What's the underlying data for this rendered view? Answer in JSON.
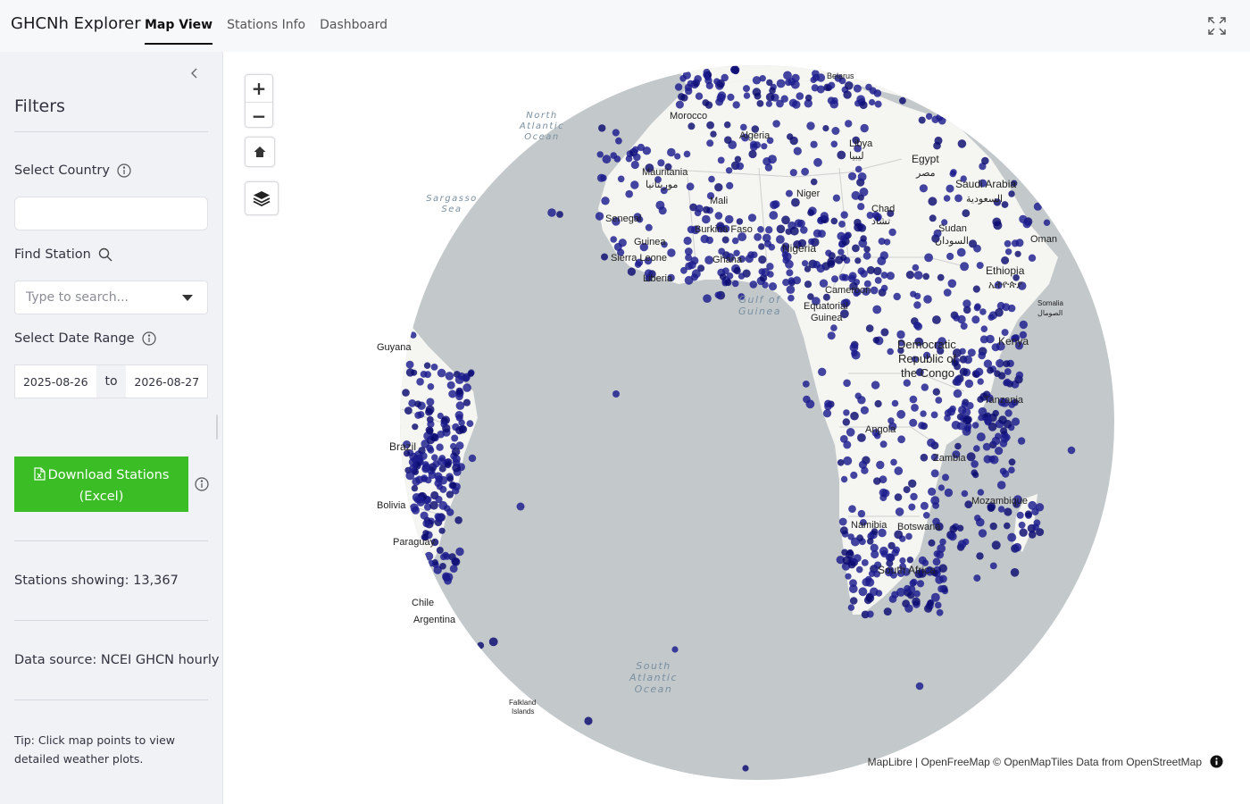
{
  "app": {
    "title": "GHCNh Explorer"
  },
  "nav": {
    "tabs": [
      {
        "label": "Map View"
      },
      {
        "label": "Stations Info"
      },
      {
        "label": "Dashboard"
      }
    ],
    "active": 0
  },
  "sidebar": {
    "title": "Filters",
    "country": {
      "label": "Select Country",
      "value": ""
    },
    "station": {
      "label": "Find Station",
      "placeholder": "Type to search..."
    },
    "date_range": {
      "label": "Select Date Range",
      "start": "2025-08-26",
      "separator": "to",
      "end": "2026-08-27"
    },
    "download": {
      "line1": "Download Stations",
      "line2": "(Excel)"
    },
    "stations_showing": "Stations showing: 13,367",
    "data_source": "Data source: NCEI GHCN hourly",
    "tip": "Tip: Click map points to view detailed weather plots."
  },
  "map": {
    "zoom_in": "+",
    "zoom_out": "−",
    "attribution": {
      "maplibre": "MapLibre",
      "sep1": " | ",
      "openfreemap": "OpenFreeMap",
      "copy": " © ",
      "openmaptiles": "OpenMapTiles",
      "data_from": " Data from ",
      "osm": "OpenStreetMap"
    },
    "ocean_labels": [
      "North",
      "Atlantic",
      "Ocean",
      "Sargasso",
      "Sea",
      "Gulf of",
      "Guinea",
      "South",
      "Atlantic",
      "Ocean"
    ],
    "country_labels": [
      "Mauritania",
      "موريتانيا",
      "Mali",
      "Niger",
      "Libya",
      "ليبيا",
      "Egypt",
      "مصر",
      "Chad",
      "تشاد",
      "Sudan",
      "السودان",
      "Saudi Arabia",
      "السعودية",
      "Oman",
      "Ethiopia",
      "ኢትዮጵያ",
      "Somalia",
      "الصومال",
      "Senegal",
      "Guinea",
      "Burkina Faso",
      "Sierra Leone",
      "Ghana",
      "Liberia",
      "Nigeria",
      "Cameroon",
      "Equatorial",
      "Guinea",
      "Democratic",
      "Republic of",
      "the Congo",
      "Kenya",
      "Tanzania",
      "Angola",
      "Zambia",
      "Mozambique",
      "Namibia",
      "Botswana",
      "South Africa",
      "Algeria",
      "Morocco",
      "Guyana",
      "Brazil",
      "Bolivia",
      "Paraguay",
      "Chile",
      "Argentina",
      "Falkland",
      "Islands",
      "Belarus"
    ],
    "colors": {
      "water": "#c3c8cb",
      "land": "#f5f5f2",
      "station": "#1c1c8e",
      "station_dark": "#0b0b70"
    }
  }
}
